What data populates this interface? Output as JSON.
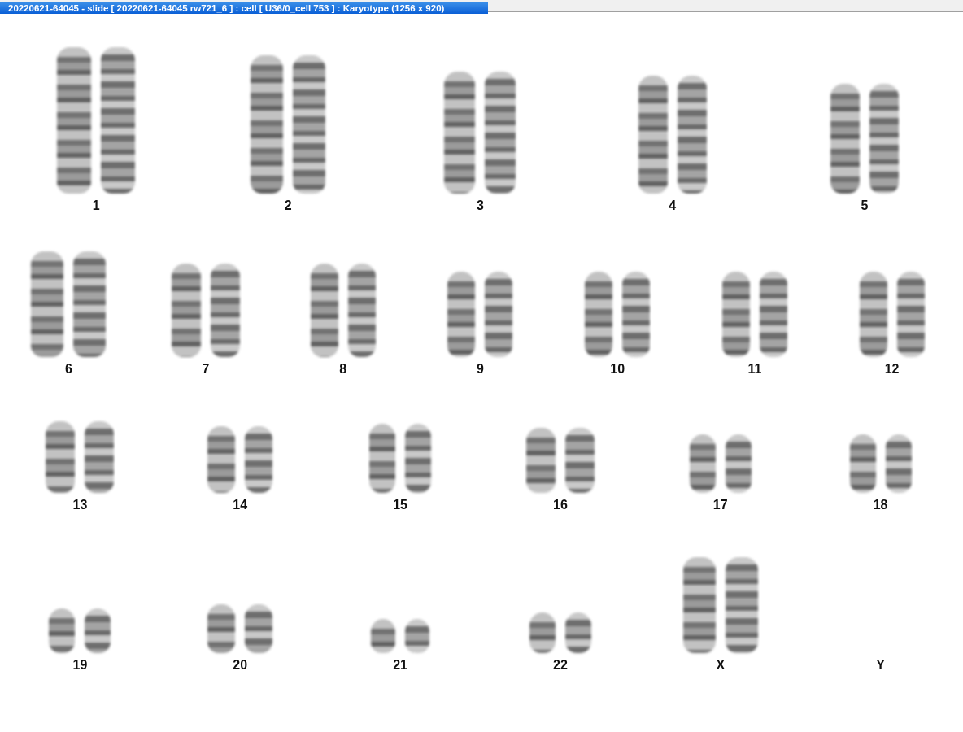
{
  "window": {
    "title": "20220621-64045 - slide [ 20220621-64045 rw721_6 ] : cell [ U36/0_cell 753 ] : Karyotype  (1256 x 920)"
  },
  "karyotype": {
    "rows": [
      {
        "items": [
          {
            "label": "1",
            "kind": "pair"
          },
          {
            "label": "2",
            "kind": "pair"
          },
          {
            "label": "3",
            "kind": "pair"
          },
          {
            "label": "4",
            "kind": "pair"
          },
          {
            "label": "5",
            "kind": "pair"
          }
        ]
      },
      {
        "items": [
          {
            "label": "6",
            "kind": "pair"
          },
          {
            "label": "7",
            "kind": "pair"
          },
          {
            "label": "8",
            "kind": "pair"
          },
          {
            "label": "9",
            "kind": "pair"
          },
          {
            "label": "10",
            "kind": "pair"
          },
          {
            "label": "11",
            "kind": "pair"
          },
          {
            "label": "12",
            "kind": "pair"
          }
        ]
      },
      {
        "items": [
          {
            "label": "13",
            "kind": "pair"
          },
          {
            "label": "14",
            "kind": "pair"
          },
          {
            "label": "15",
            "kind": "pair"
          },
          {
            "label": "16",
            "kind": "pair"
          },
          {
            "label": "17",
            "kind": "pair"
          },
          {
            "label": "18",
            "kind": "pair"
          }
        ]
      },
      {
        "items": [
          {
            "label": "19",
            "kind": "pair"
          },
          {
            "label": "20",
            "kind": "pair"
          },
          {
            "label": "21",
            "kind": "pair"
          },
          {
            "label": "22",
            "kind": "pair"
          },
          {
            "label": "X",
            "kind": "pair"
          },
          {
            "label": "Y",
            "kind": "none"
          }
        ]
      }
    ]
  }
}
